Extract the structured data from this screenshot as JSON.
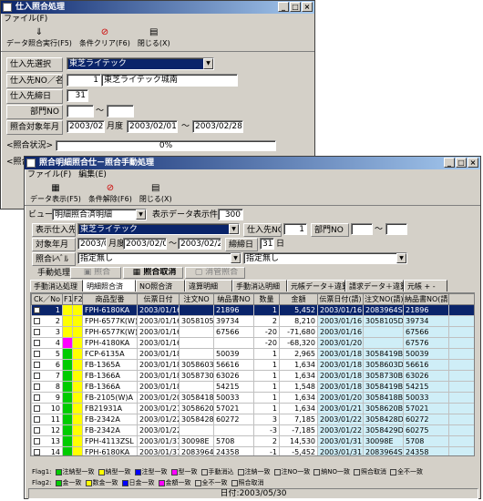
{
  "back": {
    "title": "仕入照合処理",
    "menu": [
      "ファイル(F)"
    ],
    "tools": [
      {
        "icon": "data-run-icon",
        "label": "データ照合実行(F5)"
      },
      {
        "icon": "clear-icon",
        "label": "条件クリア(F6)"
      },
      {
        "icon": "close-icon",
        "label": "閉じる(X)"
      }
    ],
    "supplier_label": "仕入先選択",
    "supplier_value": "東芝ライテック",
    "no_label": "仕入先NO／名",
    "no_value": "1",
    "name_value": "東芝ライテック城南",
    "close_label": "仕入先締日",
    "close_value": "31",
    "dept_label": "部門NO",
    "dept_sep": "～",
    "ym_label": "照合対象年月",
    "ym_value": "2003/02",
    "ym_unit": "月度",
    "from_date": "2003/02/01",
    "to_sep": "～",
    "to_date": "2003/02/28",
    "status_label": "<照合状況>",
    "progress": "0%",
    "status2_label": "<照合"
  },
  "front": {
    "title": "照合明細照合仕－照合手動処理",
    "menu": [
      "ファイル(F)",
      "編集(E)"
    ],
    "tools": [
      {
        "icon": "data-display-icon",
        "label": "データ表示(F5)"
      },
      {
        "icon": "condition-clear-icon",
        "label": "条件解除(F6)"
      },
      {
        "icon": "close-icon",
        "label": "閉じる(X)"
      }
    ],
    "view_label": "ビュー:",
    "view_value": "明細照合済明細",
    "count_label": "表示データ表示件数:",
    "count_value": "300",
    "supplier_label": "表示仕入先",
    "supplier_value": "東芝ライテック",
    "supno_label": "仕入先NO",
    "supno_value": "1",
    "dept_label": "部門NO",
    "dept_sep": "～",
    "ym_label": "対象年月",
    "ym_value": "2003/02",
    "ym_unit": "月度",
    "from": "2003/02/01",
    "sep": "～",
    "to": "2003/02/28",
    "close_label": "締締日",
    "close_value": "31",
    "close_unit": "日",
    "level_label": "照合ﾚﾍﾞﾙ",
    "level_value": "指定無し",
    "level2_value": "指定無し",
    "manual_label": "手動処理:",
    "btn1": "照合",
    "btn2": "照合取消",
    "btn3": "消管照合",
    "tabs": [
      "手動消込処理",
      "明細照合済",
      "NO照合済",
      "違算明細",
      "手動消込明細",
      "元帳データ＋違算",
      "請求データ＋違算",
      "元帳 + -"
    ],
    "cols": [
      "Ck／No",
      "F1",
      "F2",
      "商品型番",
      "伝票日付",
      "注文NO",
      "納品書NO",
      "数量",
      "金額",
      "伝票日付(請)",
      "注文NO(請)",
      "納品書NO(請)"
    ],
    "rows": [
      [
        "1",
        "#ffff00",
        "#ffff00",
        "FPH-6180KA",
        "2003/01/16",
        "",
        "21896",
        "1",
        "5,452",
        "2003/01/16",
        "2083964S",
        "21896"
      ],
      [
        "2",
        "#ffff00",
        "#ffff00",
        "FPH-6577K(W)A",
        "2003/01/16",
        "3058105D",
        "39734",
        "2",
        "8,210",
        "2003/01/16",
        "3058105D",
        "39734"
      ],
      [
        "3",
        "#ffff00",
        "#ffff00",
        "FPH-6577K(W)A",
        "2003/01/16",
        "",
        "67566",
        "-20",
        "-71,680",
        "2003/01/16",
        "",
        "67566"
      ],
      [
        "4",
        "#ff00ff",
        "#ffff00",
        "FPH-4180KA",
        "2003/01/16",
        "",
        "",
        "-20",
        "-68,320",
        "2003/01/20",
        "",
        "67576"
      ],
      [
        "5",
        "#00cc00",
        "#ffff00",
        "FCP-6135A",
        "2003/01/18",
        "",
        "50039",
        "1",
        "2,965",
        "2003/01/18",
        "3058419B",
        "50039"
      ],
      [
        "6",
        "#00cc00",
        "#ffff00",
        "FB-1365A",
        "2003/01/18",
        "3058603D",
        "56616",
        "1",
        "1,634",
        "2003/01/18",
        "3058603D",
        "56616"
      ],
      [
        "7",
        "#00cc00",
        "#ffff00",
        "FB-1366A",
        "2003/01/18",
        "3058730B",
        "63026",
        "1",
        "1,634",
        "2003/01/18",
        "3058730B",
        "63026"
      ],
      [
        "8",
        "#00cc00",
        "#ffff00",
        "FB-1366A",
        "2003/01/18",
        "",
        "54215",
        "1",
        "1,548",
        "2003/01/18",
        "3058419B",
        "54215"
      ],
      [
        "9",
        "#00cc00",
        "#ffff00",
        "FB-2105(W)A",
        "2003/01/20",
        "3058418B",
        "50033",
        "1",
        "1,634",
        "2003/01/20",
        "3058418B",
        "50033"
      ],
      [
        "10",
        "#00cc00",
        "#ffff00",
        "FB21931A",
        "2003/01/21",
        "3058620B",
        "57021",
        "1",
        "1,634",
        "2003/01/21",
        "3058620B",
        "57021"
      ],
      [
        "11",
        "#00cc00",
        "#ffff00",
        "FB-2342A",
        "2003/01/22",
        "3058428D",
        "60272",
        "3",
        "7,185",
        "2003/01/22",
        "3058428D",
        "60272"
      ],
      [
        "12",
        "#00cc00",
        "#ffff00",
        "FB-2342A",
        "2003/01/22",
        "",
        "",
        "-3",
        "-7,185",
        "2003/01/22",
        "3058429D",
        "60275"
      ],
      [
        "13",
        "#00cc00",
        "#ffff00",
        "FPH-4113ZSL",
        "2003/01/31",
        "30098E",
        "5708",
        "2",
        "14,530",
        "2003/01/31",
        "30098E",
        "5708"
      ],
      [
        "14",
        "#00cc00",
        "#ffff00",
        "FPH-6180KA",
        "2003/01/31",
        "2083964S",
        "24358",
        "-1",
        "-5,452",
        "2003/01/31",
        "2083964S",
        "24358"
      ]
    ],
    "legend1": [
      {
        "name": "Flag1:",
        "color": ""
      },
      {
        "name": "注納型一致",
        "color": "#00cc00"
      },
      {
        "name": "納型一致",
        "color": "#ffff00"
      },
      {
        "name": "注型一致",
        "color": "#0000ff"
      },
      {
        "name": "型一致",
        "color": "#ff00ff"
      },
      {
        "name": "手動消込",
        "color": "#d4d0c8"
      },
      {
        "name": "注納一致",
        "color": "#d4d0c8"
      },
      {
        "name": "注NO一致",
        "color": "#d4d0c8"
      },
      {
        "name": "納NO一致",
        "color": "#d4d0c8"
      },
      {
        "name": "照合取消",
        "color": "#d4d0c8"
      },
      {
        "name": "全不一致",
        "color": "#d4d0c8"
      }
    ],
    "legend2": [
      {
        "name": "Flag2:",
        "color": ""
      },
      {
        "name": "金一致",
        "color": "#00cc00"
      },
      {
        "name": "数金一致",
        "color": "#ffff00"
      },
      {
        "name": "日金一致",
        "color": "#0000ff"
      },
      {
        "name": "金額一致",
        "color": "#ff00ff"
      },
      {
        "name": "全不一致",
        "color": "#d4d0c8"
      },
      {
        "name": "照合取消",
        "color": "#d4d0c8"
      }
    ],
    "status": "日付:2003/05/30"
  }
}
